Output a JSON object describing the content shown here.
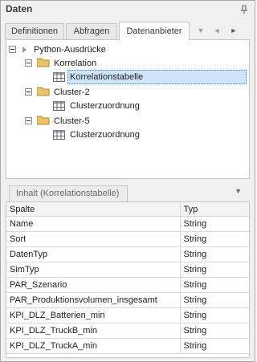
{
  "panel": {
    "title": "Daten",
    "pin_icon": "pin-icon"
  },
  "tabs": [
    {
      "label": "Definitionen",
      "active": false
    },
    {
      "label": "Abfragen",
      "active": false
    },
    {
      "label": "Datenanbieter",
      "active": true
    }
  ],
  "tab_nav": {
    "menu": "▼",
    "prev": "◄",
    "next": "►"
  },
  "tree": {
    "root": {
      "label": "Python-Ausdrücke"
    },
    "groups": [
      {
        "label": "Korrelation",
        "child": "Korrelationstabelle",
        "child_selected": true
      },
      {
        "label": "Cluster-2",
        "child": "Clusterzuordnung",
        "child_selected": false
      },
      {
        "label": "Cluster-5",
        "child": "Clusterzuordnung",
        "child_selected": false
      }
    ]
  },
  "content": {
    "tab_label": "Inhalt (Korrelationstabelle)",
    "menu": "▼",
    "columns": [
      "Spalte",
      "Typ"
    ],
    "rows": [
      [
        "Name",
        "String"
      ],
      [
        "Sort",
        "String"
      ],
      [
        "DatenTyp",
        "String"
      ],
      [
        "SimTyp",
        "String"
      ],
      [
        "PAR_Szenario",
        "String"
      ],
      [
        "PAR_Produktionsvolumen_insgesamt",
        "String"
      ],
      [
        "KPI_DLZ_Batterien_min",
        "String"
      ],
      [
        "KPI_DLZ_TruckB_min",
        "String"
      ],
      [
        "KPI_DLZ_TruckA_min",
        "String"
      ]
    ]
  }
}
